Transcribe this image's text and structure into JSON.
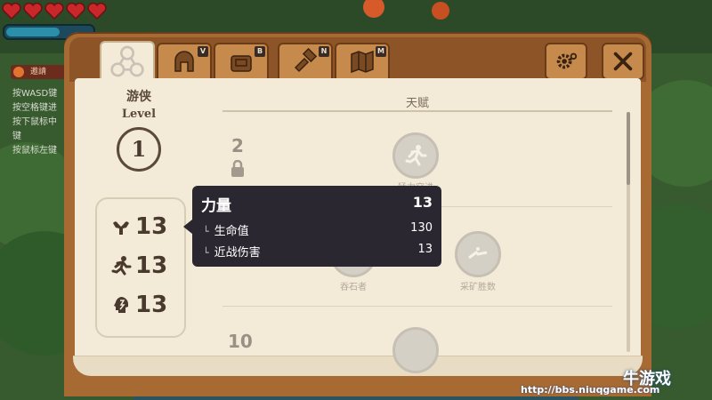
{
  "hud": {
    "hearts": 5,
    "heart_color": "#c8282a",
    "quest_header": "邀請",
    "quest_lines": [
      "按WASD键",
      "按空格键进",
      "按下鼠标中",
      "键",
      "按鼠标左键"
    ]
  },
  "tabs": [
    {
      "name": "character",
      "icon": "class-icon",
      "active": true
    },
    {
      "name": "equipment",
      "icon": "helmet-icon",
      "key": "V"
    },
    {
      "name": "inventory",
      "icon": "bag-icon",
      "key": "B"
    },
    {
      "name": "crafting",
      "icon": "hammer-icon",
      "key": "N"
    },
    {
      "name": "map",
      "icon": "map-icon",
      "key": "M"
    }
  ],
  "buttons": {
    "settings_icon": "gear-icon",
    "close_icon": "close-icon"
  },
  "character": {
    "class_name": "游侠",
    "level_label": "Level",
    "level": "1",
    "stats": [
      {
        "icon": "strength-icon",
        "value": "13"
      },
      {
        "icon": "dexterity-icon",
        "value": "13"
      },
      {
        "icon": "intelligence-icon",
        "value": "13"
      }
    ]
  },
  "talents": {
    "title": "天赋",
    "tiers": [
      {
        "required_level": "2",
        "locked": true
      },
      {
        "required_level": "10",
        "locked": true
      }
    ],
    "skills": [
      {
        "label": "猛力突进",
        "icon": "sprint-icon"
      },
      {
        "label": "吞石者",
        "icon": "stone-icon"
      },
      {
        "label": "采矿胜数",
        "icon": "mining-icon"
      }
    ]
  },
  "tooltip": {
    "title": "力量",
    "total": "13",
    "rows": [
      {
        "label": "生命值",
        "value": "130"
      },
      {
        "label": "近战伤害",
        "value": "13"
      }
    ]
  },
  "watermark": {
    "logo": "牛游戏",
    "url": "http://bbs.niuqgame.com"
  },
  "colors": {
    "parchment": "#f3ead8",
    "wood": "#a76a33",
    "tooltip_bg": "#2b2730"
  }
}
